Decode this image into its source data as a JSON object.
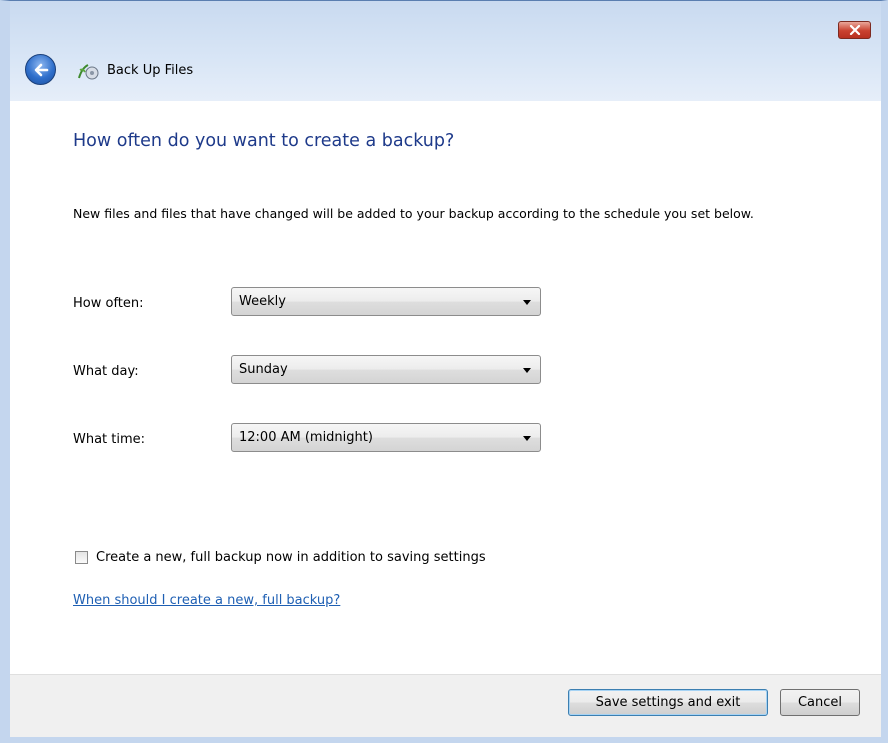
{
  "window": {
    "title": "Back Up Files",
    "close_glyph": "✕"
  },
  "icons": {
    "back": "back-arrow-icon",
    "app": "backup-icon",
    "close": "close-icon"
  },
  "page": {
    "heading": "How often do you want to create a backup?",
    "description": "New files and files that have changed will be added to your backup according to the schedule you set below."
  },
  "schedule": {
    "how_often_label": "How often:",
    "how_often_value": "Weekly",
    "what_day_label": "What day:",
    "what_day_value": "Sunday",
    "what_time_label": "What time:",
    "what_time_value": "12:00 AM (midnight)"
  },
  "options": {
    "full_backup_label": "Create a new, full backup now in addition to saving settings",
    "full_backup_checked": false,
    "help_link": "When should I create a new, full backup?"
  },
  "buttons": {
    "save": "Save settings and exit",
    "cancel": "Cancel"
  },
  "colors": {
    "heading": "#1e3a8a",
    "link": "#1e5fb3",
    "close_button": "#c9412f",
    "back_button": "#2f6fcb"
  }
}
